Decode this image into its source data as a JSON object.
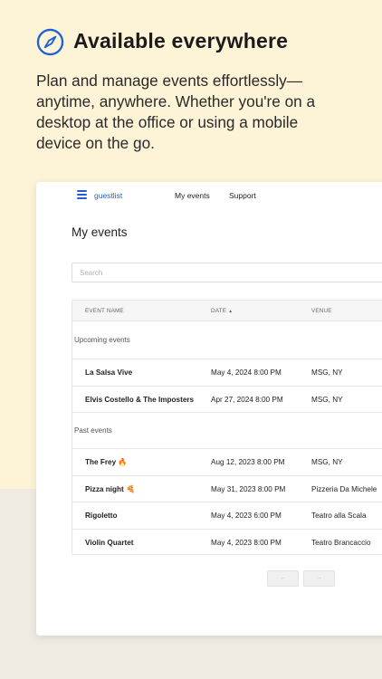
{
  "hero": {
    "title": "Available everywhere",
    "description": "Plan and manage events effortlessly—anytime, anywhere. Whether you're on a desktop at the office or using a mobile device on the go.",
    "accent_color": "#1f5fd8",
    "icon": "compass-icon"
  },
  "app": {
    "brand": "guestlist",
    "nav": [
      "My events",
      "Support"
    ],
    "page_title": "My events",
    "search_placeholder": "Search",
    "columns": {
      "name": "EVENT NAME",
      "date": "DATE",
      "date_sort": "▲",
      "venue": "VENUE"
    },
    "upcoming_label": "Upcoming events",
    "upcoming": [
      {
        "name": "La Salsa Vive",
        "date": "May 4, 2024 8:00 PM",
        "venue": "MSG, NY"
      },
      {
        "name": "Elvis Costello & The Imposters",
        "date": "Apr 27, 2024 8:00 PM",
        "venue": "MSG, NY"
      }
    ],
    "past_label": "Past events",
    "past": [
      {
        "name": "The Frey 🔥",
        "date": "Aug 12, 2023 8:00 PM",
        "venue": "MSG, NY"
      },
      {
        "name": "Pizza night 🍕",
        "date": "May 31, 2023 8:00 PM",
        "venue": "Pizzeria Da Michele"
      },
      {
        "name": "Rigoletto",
        "date": "May 4, 2023 6:00 PM",
        "venue": "Teatro alla Scala"
      },
      {
        "name": "Violin Quartet",
        "date": "May 4, 2023 8:00 PM",
        "venue": "Teatro Brancaccio"
      }
    ],
    "pager": {
      "prev": "←",
      "next": "→"
    }
  }
}
